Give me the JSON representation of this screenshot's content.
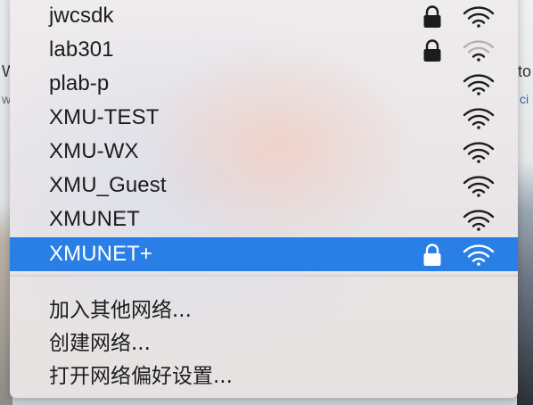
{
  "networks": [
    {
      "name": "jwcsdk",
      "locked": true,
      "signal": 3,
      "selected": false
    },
    {
      "name": "lab301",
      "locked": true,
      "signal": 1,
      "selected": false
    },
    {
      "name": "plab-p",
      "locked": false,
      "signal": 3,
      "selected": false
    },
    {
      "name": "XMU-TEST",
      "locked": false,
      "signal": 3,
      "selected": false
    },
    {
      "name": "XMU-WX",
      "locked": false,
      "signal": 3,
      "selected": false
    },
    {
      "name": "XMU_Guest",
      "locked": false,
      "signal": 3,
      "selected": false
    },
    {
      "name": "XMUNET",
      "locked": false,
      "signal": 3,
      "selected": false
    },
    {
      "name": "XMUNET+",
      "locked": true,
      "signal": 3,
      "selected": true
    }
  ],
  "actions": {
    "join_other": "加入其他网络...",
    "create": "创建网络...",
    "open_prefs": "打开网络偏好设置..."
  },
  "icons": {
    "lock": "lock-icon",
    "wifi": "wifi-signal-icon"
  },
  "colors": {
    "selection": "#2a7fe6",
    "text": "#1c1c1c",
    "wifi_strong": "#1c1c1c",
    "wifi_weak": "#b5b1b1"
  },
  "background": {
    "left_fragments": [
      "W",
      "w"
    ],
    "right_fragments": [
      "to",
      "ci"
    ]
  }
}
